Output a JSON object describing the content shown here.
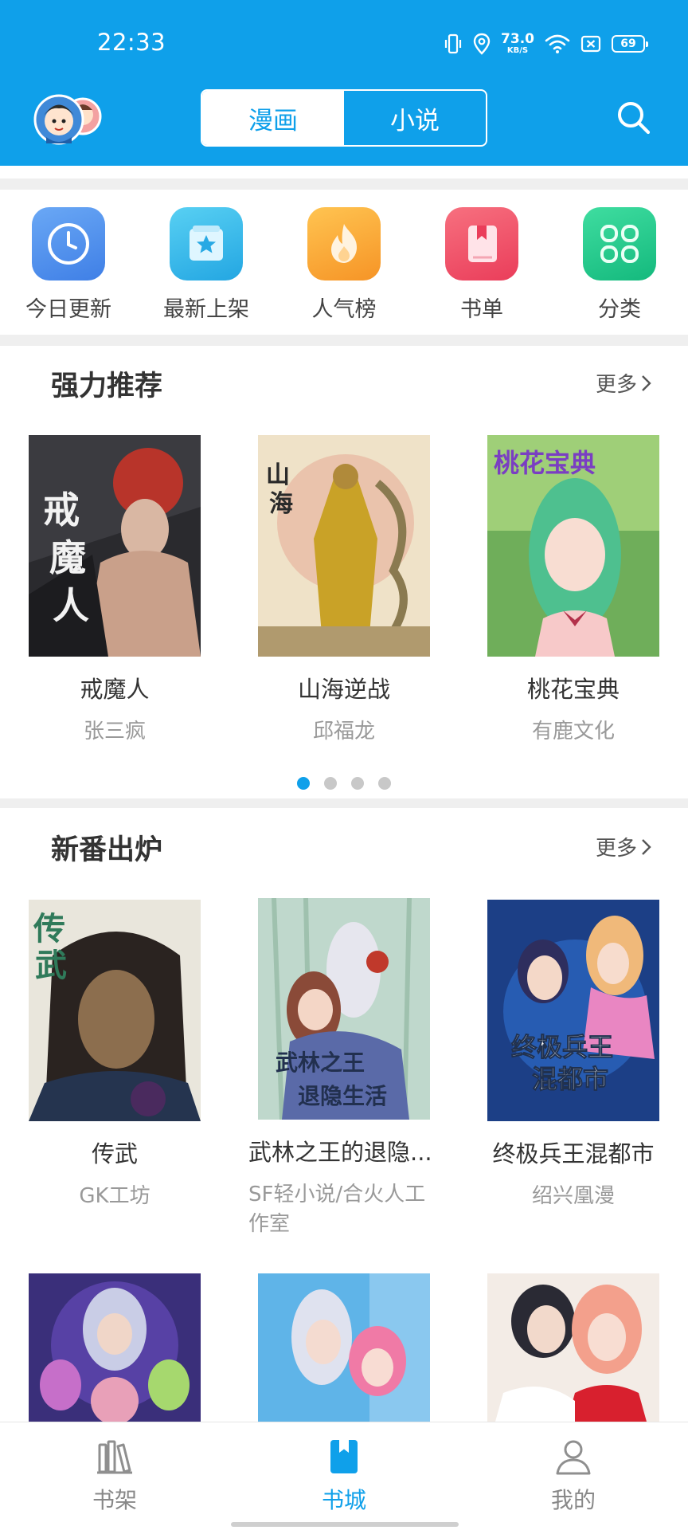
{
  "status_bar": {
    "time": "22:33",
    "net_speed_value": "73.0",
    "net_speed_unit": "KB/S",
    "battery": "69"
  },
  "header": {
    "tabs": [
      {
        "label": "漫画",
        "active": true
      },
      {
        "label": "小说",
        "active": false
      }
    ],
    "accent_color": "#0fa0ea"
  },
  "quick_links": [
    {
      "label": "今日更新",
      "icon": "clock-icon",
      "color": "#4a90ee"
    },
    {
      "label": "最新上架",
      "icon": "star-box-icon",
      "color": "#2fb8ea"
    },
    {
      "label": "人气榜",
      "icon": "flame-icon",
      "color": "#f6a12b"
    },
    {
      "label": "书单",
      "icon": "book-bookmark-icon",
      "color": "#ef5068"
    },
    {
      "label": "分类",
      "icon": "grid-icon",
      "color": "#22c98a"
    }
  ],
  "recommend": {
    "title": "强力推荐",
    "more": "更多",
    "books": [
      {
        "title": "戒魔人",
        "author": "张三疯"
      },
      {
        "title": "山海逆战",
        "author": "邱福龙"
      },
      {
        "title": "桃花宝典",
        "author": "有鹿文化"
      }
    ],
    "page_count": 4,
    "current_page": 1
  },
  "new_releases": {
    "title": "新番出炉",
    "more": "更多",
    "books": [
      {
        "title": "传武",
        "author": "GK工坊"
      },
      {
        "title": "武林之王的退隐...",
        "author": "SF轻小说/合火人工作室"
      },
      {
        "title": "终极兵王混都市",
        "author": "绍兴凰漫"
      }
    ]
  },
  "bottom_nav": [
    {
      "label": "书架",
      "icon": "bookshelf-icon",
      "active": false
    },
    {
      "label": "书城",
      "icon": "bookstore-icon",
      "active": true
    },
    {
      "label": "我的",
      "icon": "user-icon",
      "active": false
    }
  ]
}
